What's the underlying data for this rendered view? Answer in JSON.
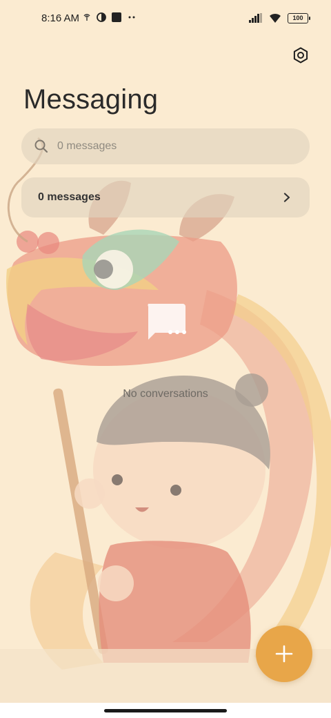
{
  "status_bar": {
    "time": "8:16 AM",
    "battery": "100"
  },
  "header": {
    "title": "Messaging"
  },
  "search": {
    "placeholder": "0 messages"
  },
  "summary": {
    "label": "0 messages"
  },
  "empty_state": {
    "text": "No conversations"
  },
  "icons": {
    "settings": "gear-icon",
    "search": "search-icon",
    "chevron": "chevron-right-icon",
    "empty": "chat-bubble-icon",
    "fab": "plus-icon"
  },
  "colors": {
    "background": "#fbebd1",
    "fab": "#e8a649",
    "pill": "#e0d4be"
  }
}
